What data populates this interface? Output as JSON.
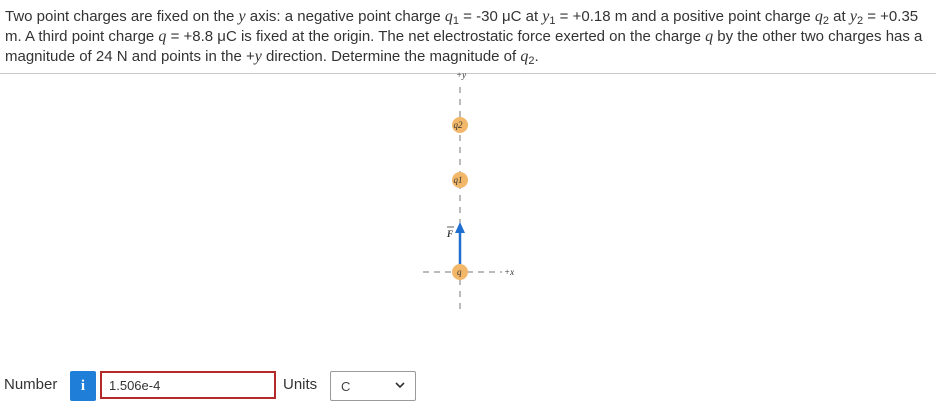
{
  "problem": {
    "t1": "Two point charges are fixed on the ",
    "y1": "y",
    "t2": " axis: a negative point charge ",
    "q1": "q",
    "q1sub": "1",
    "t3": " = -30 μC at ",
    "yv1": "y",
    "yv1sub": "1",
    "t4": " = +0.18 m and a positive point charge ",
    "q2": "q",
    "q2sub": "2",
    "t5": " at ",
    "yv2": "y",
    "yv2sub": "2",
    "t6": " = +0.35 m. A third point charge ",
    "q": "q",
    "t7": " = +8.8 μC is fixed at the origin. The net electrostatic force exerted on the charge ",
    "qb": "q",
    "t8": " by the other two charges has a magnitude of 24 N and points in the +",
    "y2": "y",
    "t9": " direction. Determine the magnitude of ",
    "q2b": "q",
    "q2bsub": "2",
    "t10": "."
  },
  "diagram": {
    "y_axis_label": "+y",
    "x_axis_label": "+x",
    "force_label": "F",
    "charge_q2": "q2",
    "charge_q1": "q1",
    "charge_q": "q",
    "charge_color": "#f2b768",
    "arrow_color": "#1f6fd1"
  },
  "answer": {
    "number_label": "Number",
    "info_icon": "i",
    "value": "1.506e-4",
    "units_label": "Units",
    "unit_selected": "C"
  }
}
